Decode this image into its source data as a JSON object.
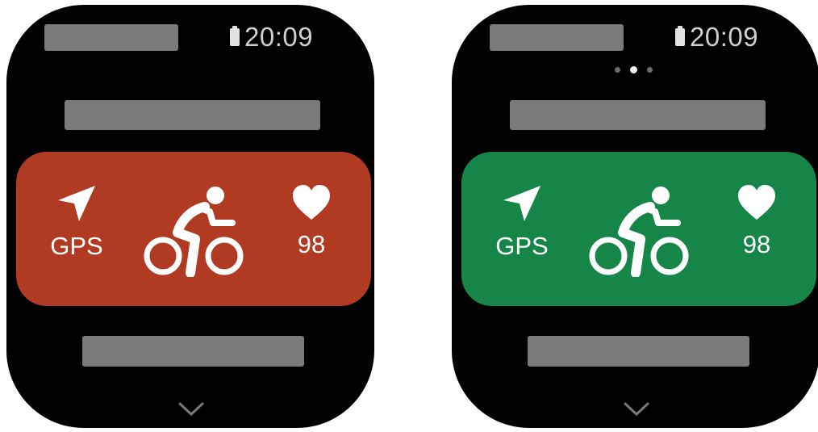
{
  "screens": [
    {
      "id": "left",
      "status_time": "20:09",
      "show_page_dots": false,
      "card_color": "#b03b22",
      "gps_label": "GPS",
      "heart_rate": "98",
      "activity_icon": "cycling-icon",
      "icons": [
        "battery-icon",
        "location-arrow-icon",
        "heart-icon",
        "chevron-down-icon"
      ]
    },
    {
      "id": "right",
      "status_time": "20:09",
      "show_page_dots": true,
      "page_dots": {
        "count": 3,
        "active_index": 1
      },
      "card_color": "#168648",
      "gps_label": "GPS",
      "heart_rate": "98",
      "activity_icon": "cycling-icon",
      "icons": [
        "battery-icon",
        "location-arrow-icon",
        "heart-icon",
        "chevron-down-icon"
      ]
    }
  ]
}
